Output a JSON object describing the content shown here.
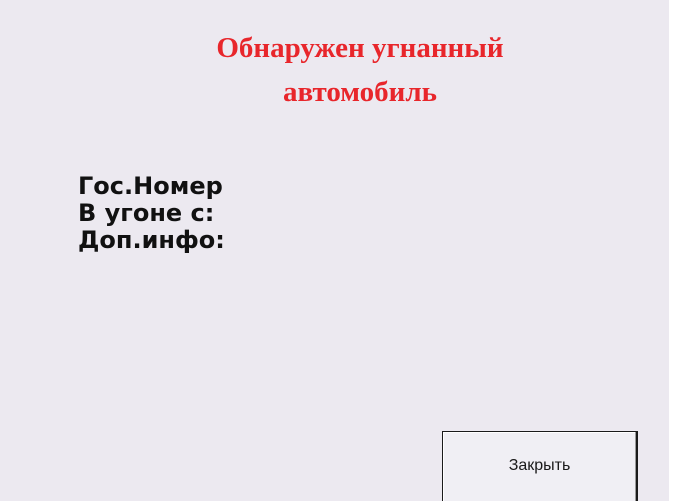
{
  "dialog": {
    "title_line1": "Обнаружен угнанный",
    "title_line2": "автомобиль",
    "fields": {
      "plate_label": "Гос.Номер",
      "stolen_since_label": "В угоне с:",
      "extra_info_label": "Доп.инфо:"
    },
    "close_button": "Закрыть"
  },
  "colors": {
    "title": "#e8262b",
    "background": "#ece9f0",
    "text": "#111111"
  }
}
